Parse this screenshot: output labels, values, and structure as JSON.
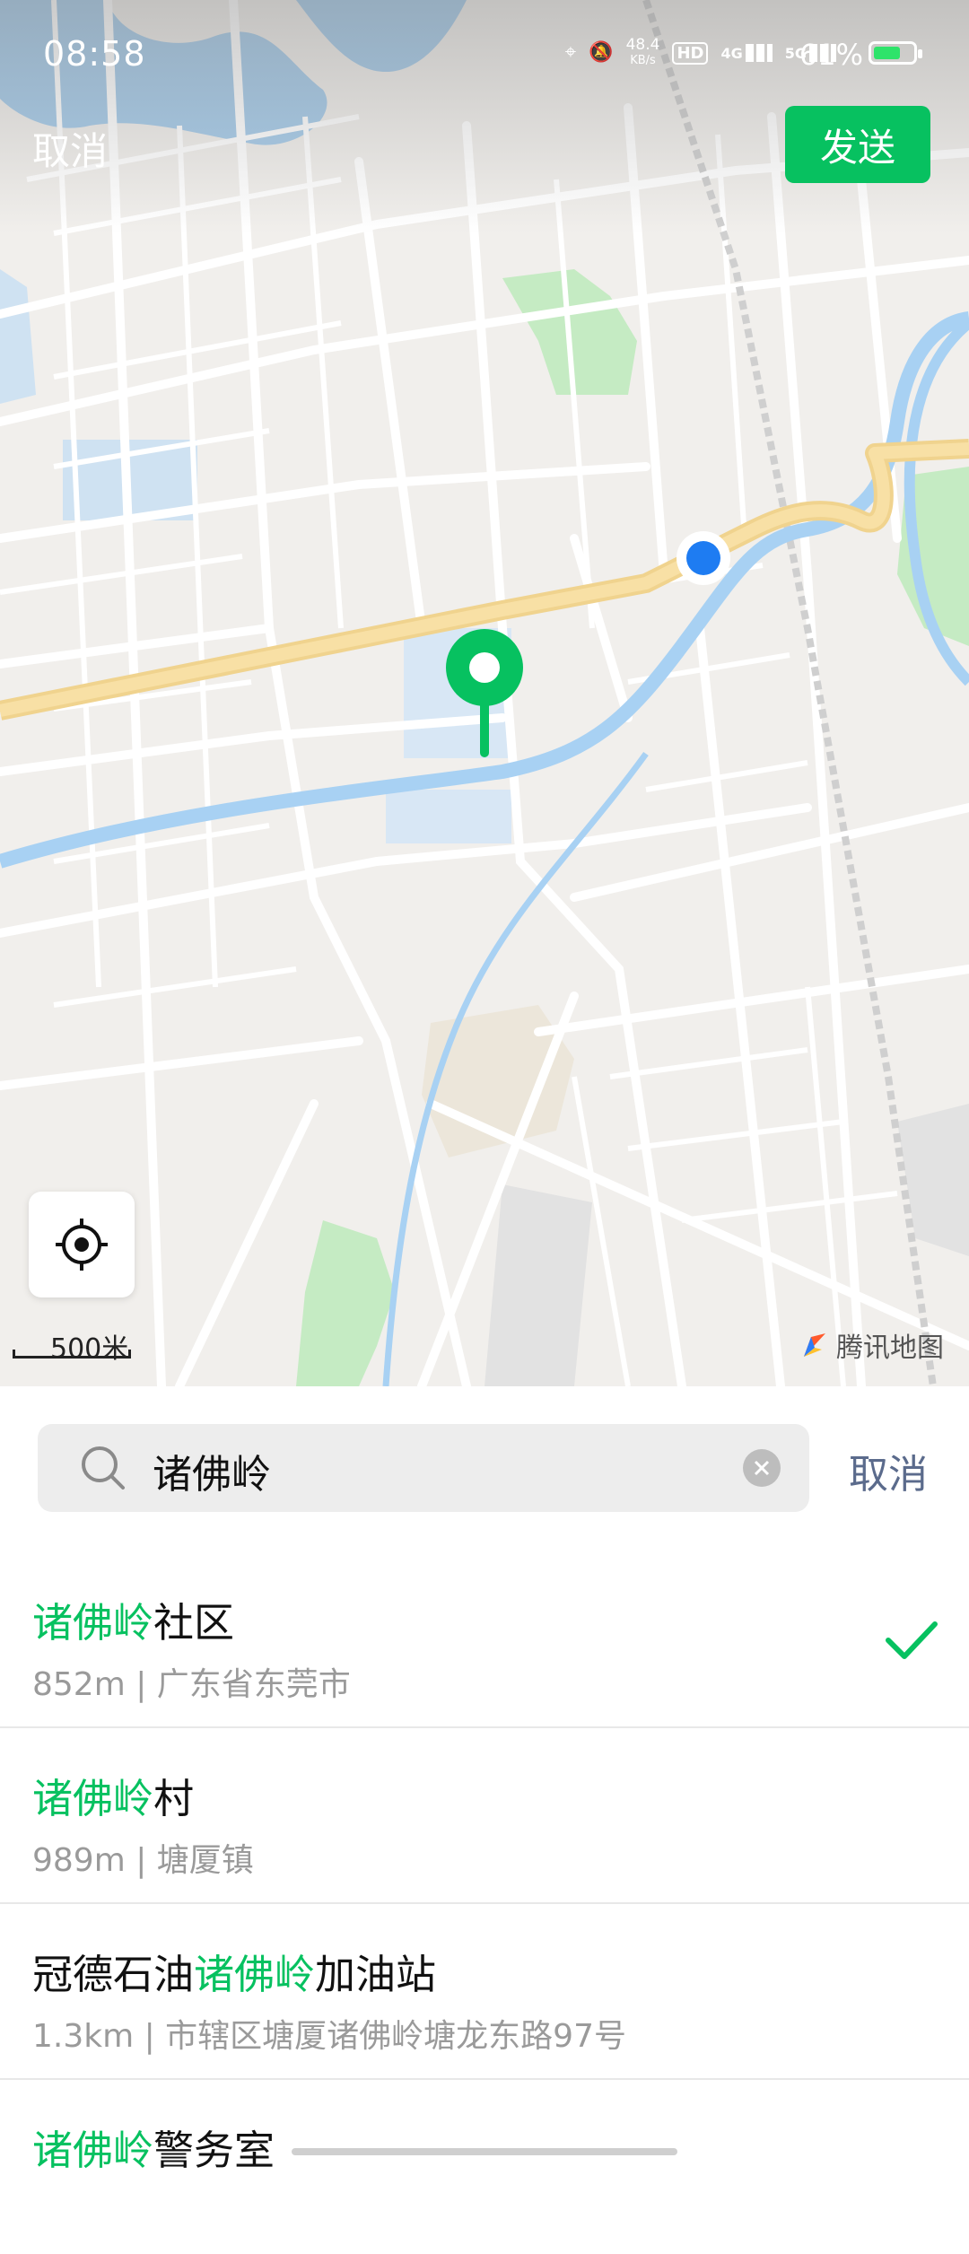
{
  "status_bar": {
    "time": "08:58",
    "net_speed": "48.4",
    "net_unit": "KB/s",
    "hd": "HD",
    "sig1": "4G",
    "sig2": "5G",
    "battery_pct": "61%"
  },
  "header": {
    "cancel_label": "取消",
    "send_label": "发送"
  },
  "map": {
    "scale_label": "500米",
    "brand_label": "腾讯地图"
  },
  "search": {
    "query": "诸佛岭",
    "cancel_label": "取消"
  },
  "results": [
    {
      "prefix": "",
      "highlight": "诸佛岭",
      "suffix": "社区",
      "sub": "852m | 广东省东莞市",
      "selected": true
    },
    {
      "prefix": "",
      "highlight": "诸佛岭",
      "suffix": "村",
      "sub": "989m | 塘厦镇",
      "selected": false
    },
    {
      "prefix": "冠德石油",
      "highlight": "诸佛岭",
      "suffix": "加油站",
      "sub": "1.3km | 市辖区塘厦诸佛岭塘龙东路97号",
      "selected": false
    },
    {
      "prefix": "",
      "highlight": "诸佛岭",
      "suffix": "警务室",
      "sub": "",
      "selected": false
    }
  ],
  "colors": {
    "accent": "#07c160",
    "link": "#5b6b8c",
    "location_dot": "#1e7cf2"
  }
}
